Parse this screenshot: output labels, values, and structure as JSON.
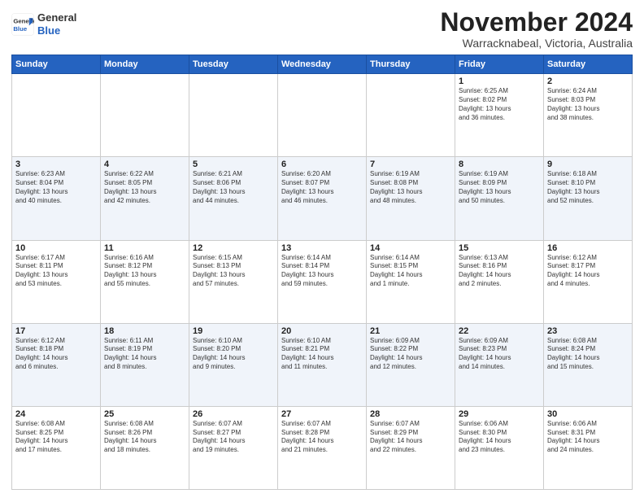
{
  "logo": {
    "general": "General",
    "blue": "Blue"
  },
  "title": "November 2024",
  "location": "Warracknabeal, Victoria, Australia",
  "headers": [
    "Sunday",
    "Monday",
    "Tuesday",
    "Wednesday",
    "Thursday",
    "Friday",
    "Saturday"
  ],
  "weeks": [
    [
      {
        "day": "",
        "info": ""
      },
      {
        "day": "",
        "info": ""
      },
      {
        "day": "",
        "info": ""
      },
      {
        "day": "",
        "info": ""
      },
      {
        "day": "",
        "info": ""
      },
      {
        "day": "1",
        "info": "Sunrise: 6:25 AM\nSunset: 8:02 PM\nDaylight: 13 hours\nand 36 minutes."
      },
      {
        "day": "2",
        "info": "Sunrise: 6:24 AM\nSunset: 8:03 PM\nDaylight: 13 hours\nand 38 minutes."
      }
    ],
    [
      {
        "day": "3",
        "info": "Sunrise: 6:23 AM\nSunset: 8:04 PM\nDaylight: 13 hours\nand 40 minutes."
      },
      {
        "day": "4",
        "info": "Sunrise: 6:22 AM\nSunset: 8:05 PM\nDaylight: 13 hours\nand 42 minutes."
      },
      {
        "day": "5",
        "info": "Sunrise: 6:21 AM\nSunset: 8:06 PM\nDaylight: 13 hours\nand 44 minutes."
      },
      {
        "day": "6",
        "info": "Sunrise: 6:20 AM\nSunset: 8:07 PM\nDaylight: 13 hours\nand 46 minutes."
      },
      {
        "day": "7",
        "info": "Sunrise: 6:19 AM\nSunset: 8:08 PM\nDaylight: 13 hours\nand 48 minutes."
      },
      {
        "day": "8",
        "info": "Sunrise: 6:19 AM\nSunset: 8:09 PM\nDaylight: 13 hours\nand 50 minutes."
      },
      {
        "day": "9",
        "info": "Sunrise: 6:18 AM\nSunset: 8:10 PM\nDaylight: 13 hours\nand 52 minutes."
      }
    ],
    [
      {
        "day": "10",
        "info": "Sunrise: 6:17 AM\nSunset: 8:11 PM\nDaylight: 13 hours\nand 53 minutes."
      },
      {
        "day": "11",
        "info": "Sunrise: 6:16 AM\nSunset: 8:12 PM\nDaylight: 13 hours\nand 55 minutes."
      },
      {
        "day": "12",
        "info": "Sunrise: 6:15 AM\nSunset: 8:13 PM\nDaylight: 13 hours\nand 57 minutes."
      },
      {
        "day": "13",
        "info": "Sunrise: 6:14 AM\nSunset: 8:14 PM\nDaylight: 13 hours\nand 59 minutes."
      },
      {
        "day": "14",
        "info": "Sunrise: 6:14 AM\nSunset: 8:15 PM\nDaylight: 14 hours\nand 1 minute."
      },
      {
        "day": "15",
        "info": "Sunrise: 6:13 AM\nSunset: 8:16 PM\nDaylight: 14 hours\nand 2 minutes."
      },
      {
        "day": "16",
        "info": "Sunrise: 6:12 AM\nSunset: 8:17 PM\nDaylight: 14 hours\nand 4 minutes."
      }
    ],
    [
      {
        "day": "17",
        "info": "Sunrise: 6:12 AM\nSunset: 8:18 PM\nDaylight: 14 hours\nand 6 minutes."
      },
      {
        "day": "18",
        "info": "Sunrise: 6:11 AM\nSunset: 8:19 PM\nDaylight: 14 hours\nand 8 minutes."
      },
      {
        "day": "19",
        "info": "Sunrise: 6:10 AM\nSunset: 8:20 PM\nDaylight: 14 hours\nand 9 minutes."
      },
      {
        "day": "20",
        "info": "Sunrise: 6:10 AM\nSunset: 8:21 PM\nDaylight: 14 hours\nand 11 minutes."
      },
      {
        "day": "21",
        "info": "Sunrise: 6:09 AM\nSunset: 8:22 PM\nDaylight: 14 hours\nand 12 minutes."
      },
      {
        "day": "22",
        "info": "Sunrise: 6:09 AM\nSunset: 8:23 PM\nDaylight: 14 hours\nand 14 minutes."
      },
      {
        "day": "23",
        "info": "Sunrise: 6:08 AM\nSunset: 8:24 PM\nDaylight: 14 hours\nand 15 minutes."
      }
    ],
    [
      {
        "day": "24",
        "info": "Sunrise: 6:08 AM\nSunset: 8:25 PM\nDaylight: 14 hours\nand 17 minutes."
      },
      {
        "day": "25",
        "info": "Sunrise: 6:08 AM\nSunset: 8:26 PM\nDaylight: 14 hours\nand 18 minutes."
      },
      {
        "day": "26",
        "info": "Sunrise: 6:07 AM\nSunset: 8:27 PM\nDaylight: 14 hours\nand 19 minutes."
      },
      {
        "day": "27",
        "info": "Sunrise: 6:07 AM\nSunset: 8:28 PM\nDaylight: 14 hours\nand 21 minutes."
      },
      {
        "day": "28",
        "info": "Sunrise: 6:07 AM\nSunset: 8:29 PM\nDaylight: 14 hours\nand 22 minutes."
      },
      {
        "day": "29",
        "info": "Sunrise: 6:06 AM\nSunset: 8:30 PM\nDaylight: 14 hours\nand 23 minutes."
      },
      {
        "day": "30",
        "info": "Sunrise: 6:06 AM\nSunset: 8:31 PM\nDaylight: 14 hours\nand 24 minutes."
      }
    ]
  ]
}
